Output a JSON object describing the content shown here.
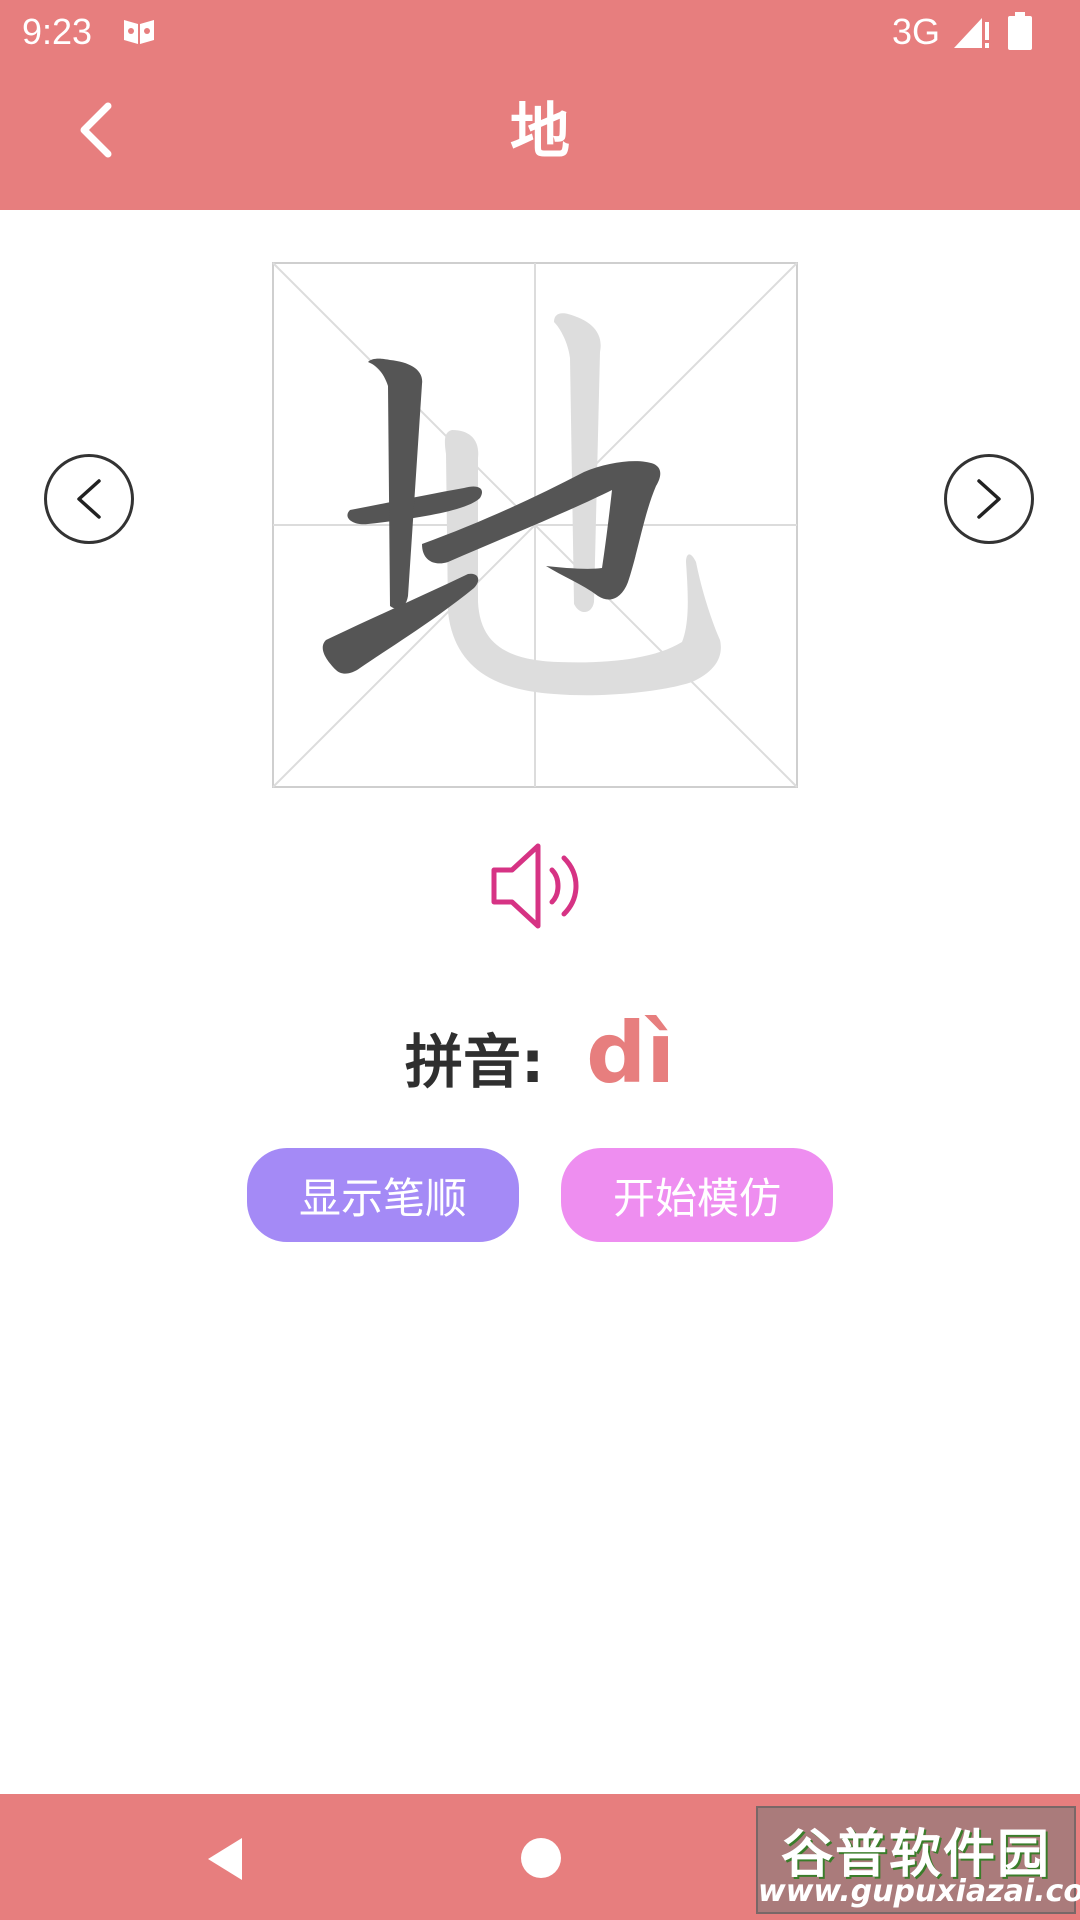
{
  "status_bar": {
    "time": "9:23",
    "app_icon": "book-icon",
    "network": "3G",
    "signal_icon": "signal-icon",
    "battery_icon": "battery-icon"
  },
  "app_bar": {
    "title": "地",
    "back_icon": "chevron-left-icon"
  },
  "character": {
    "glyph": "地",
    "prev_icon": "chevron-left-icon",
    "next_icon": "chevron-right-icon"
  },
  "audio": {
    "icon": "speaker-icon"
  },
  "pinyin": {
    "label": "拼音:",
    "value": "dì"
  },
  "buttons": {
    "show_stroke_order": "显示笔顺",
    "start_imitation": "开始模仿"
  },
  "nav_bar": {
    "back_icon": "triangle-back-icon",
    "home_icon": "circle-home-icon"
  },
  "watermark": {
    "title": "谷普软件园",
    "url": "www.gupuxiazai.com"
  },
  "colors": {
    "header": "#e77e7e",
    "accent": "#e77e7e",
    "speaker": "#d63384",
    "stroke_button": "#a48af6",
    "imitate_button": "#ee8ef0",
    "grid_line": "#d6d6d6",
    "glyph_done": "#555555",
    "glyph_pending": "#dddddd"
  }
}
